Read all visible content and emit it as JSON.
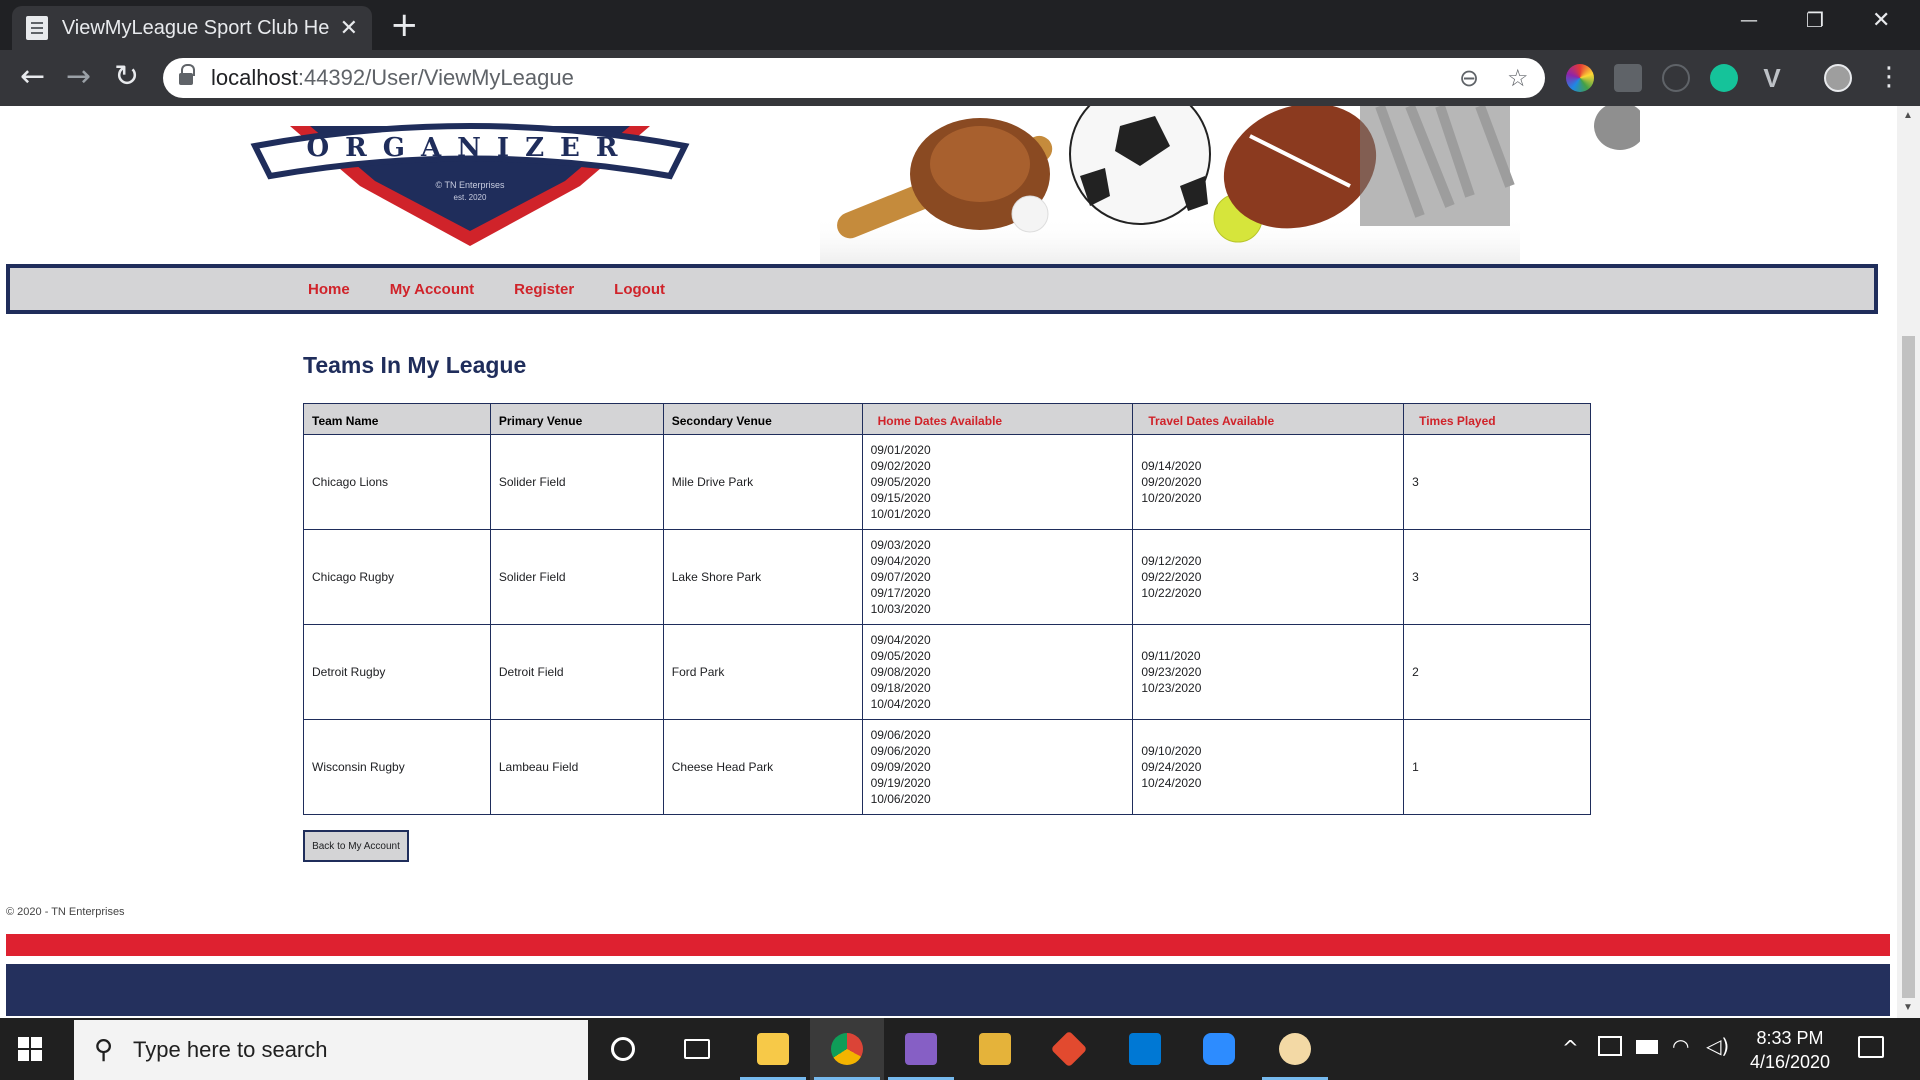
{
  "browser": {
    "tab_title": "ViewMyLeague Sport Club Helper",
    "tab_close": "✕",
    "new_tab": "+",
    "url_host": "localhost",
    "url_path": ":44392/User/ViewMyLeague",
    "window_minimize": "—",
    "window_restore": "❐",
    "window_close": "✕",
    "back": "←",
    "forward": "→",
    "reload": "↻",
    "zoom_icon": "⊖",
    "star_icon": "☆",
    "menu_icon": "⋮"
  },
  "banner": {
    "logo_word": "ORGANIZER",
    "logo_company": "© TN Enterprises",
    "logo_est": "est. 2020"
  },
  "nav": {
    "items": [
      {
        "label": "Home"
      },
      {
        "label": "My Account"
      },
      {
        "label": "Register"
      },
      {
        "label": "Logout"
      }
    ]
  },
  "page": {
    "title": "Teams In My League",
    "back_button": "Back to My Account",
    "footer": "© 2020 - TN Enterprises"
  },
  "table": {
    "headers": [
      "Team Name",
      "Primary Venue",
      "Secondary Venue",
      "Home Dates Available",
      "Travel Dates Available",
      "Times Played"
    ],
    "rows": [
      {
        "team": "Chicago Lions",
        "primary": "Solider Field",
        "secondary": "Mile Drive Park",
        "home_dates": [
          "09/01/2020",
          "09/02/2020",
          "09/05/2020",
          "09/15/2020",
          "10/01/2020"
        ],
        "travel_dates": [
          "09/14/2020",
          "09/20/2020",
          "10/20/2020"
        ],
        "times_played": "3"
      },
      {
        "team": "Chicago Rugby",
        "primary": "Solider Field",
        "secondary": "Lake Shore Park",
        "home_dates": [
          "09/03/2020",
          "09/04/2020",
          "09/07/2020",
          "09/17/2020",
          "10/03/2020"
        ],
        "travel_dates": [
          "09/12/2020",
          "09/22/2020",
          "10/22/2020"
        ],
        "times_played": "3"
      },
      {
        "team": "Detroit Rugby",
        "primary": "Detroit Field",
        "secondary": "Ford Park",
        "home_dates": [
          "09/04/2020",
          "09/05/2020",
          "09/08/2020",
          "09/18/2020",
          "10/04/2020"
        ],
        "travel_dates": [
          "09/11/2020",
          "09/23/2020",
          "10/23/2020"
        ],
        "times_played": "2"
      },
      {
        "team": "Wisconsin Rugby",
        "primary": "Lambeau Field",
        "secondary": "Cheese Head Park",
        "home_dates": [
          "09/06/2020",
          "09/06/2020",
          "09/09/2020",
          "09/19/2020",
          "10/06/2020"
        ],
        "travel_dates": [
          "09/10/2020",
          "09/24/2020",
          "10/24/2020"
        ],
        "times_played": "1"
      }
    ]
  },
  "taskbar": {
    "search_placeholder": "Type here to search",
    "time": "8:33 PM",
    "date": "4/16/2020"
  },
  "colors": {
    "navy": "#1f2d5b",
    "red": "#d0232a",
    "nav_bg": "#d4d4d6"
  }
}
